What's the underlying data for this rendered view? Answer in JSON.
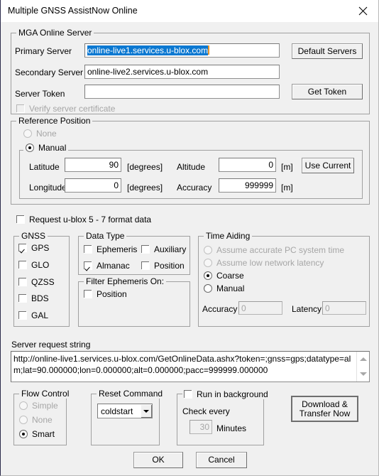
{
  "window": {
    "title": "Multiple GNSS AssistNow Online",
    "close_icon": "close-icon"
  },
  "mga_online_server": {
    "legend": "MGA Online Server",
    "primary_label": "Primary Server",
    "primary_value": "online-live1.services.u-blox.com",
    "secondary_label": "Secondary Server",
    "secondary_value": "online-live2.services.u-blox.com",
    "token_label": "Server Token",
    "token_value": "",
    "token_placeholder": "",
    "default_servers_button": "Default Servers",
    "get_token_button": "Get Token",
    "verify_cert_label": "Verify server certificate",
    "verify_cert_checked": false,
    "verify_cert_enabled": false
  },
  "reference_position": {
    "legend": "Reference Position",
    "none_label": "None",
    "manual_label": "Manual",
    "selected": "Manual",
    "latitude_label": "Latitude",
    "latitude_value": "90",
    "latitude_units": "[degrees]",
    "longitude_label": "Longitude",
    "longitude_value": "0",
    "longitude_units": "[degrees]",
    "altitude_label": "Altitude",
    "altitude_value": "0",
    "altitude_units": "[m]",
    "accuracy_label": "Accuracy",
    "accuracy_value": "999999",
    "accuracy_units": "[m]",
    "use_current_button": "Use Current"
  },
  "request_legacy_format": {
    "label": "Request u-blox 5 - 7 format data",
    "checked": false
  },
  "gnss": {
    "legend": "GNSS",
    "items": [
      {
        "label": "GPS",
        "checked": true
      },
      {
        "label": "GLO",
        "checked": false
      },
      {
        "label": "QZSS",
        "checked": false
      },
      {
        "label": "BDS",
        "checked": false
      },
      {
        "label": "GAL",
        "checked": false
      }
    ]
  },
  "data_type": {
    "legend": "Data Type",
    "items": [
      {
        "label": "Ephemeris",
        "checked": false
      },
      {
        "label": "Auxiliary",
        "checked": false
      },
      {
        "label": "Almanac",
        "checked": true
      },
      {
        "label": "Position",
        "checked": false
      }
    ]
  },
  "filter_ephemeris": {
    "legend": "Filter Ephemeris On:",
    "position_label": "Position",
    "position_checked": false
  },
  "time_aiding": {
    "legend": "Time Aiding",
    "options": [
      {
        "label": "Assume accurate PC system time",
        "selected": false,
        "enabled": false
      },
      {
        "label": "Assume low network latency",
        "selected": false,
        "enabled": false
      },
      {
        "label": "Coarse",
        "selected": true,
        "enabled": true
      },
      {
        "label": "Manual",
        "selected": false,
        "enabled": true
      }
    ],
    "accuracy_label": "Accuracy",
    "accuracy_value": "0",
    "accuracy_enabled": false,
    "latency_label": "Latency",
    "latency_value": "0",
    "latency_enabled": false
  },
  "server_request": {
    "label": "Server request string",
    "value": "http://online-live1.services.u-blox.com/GetOnlineData.ashx?token=;gnss=gps;datatype=alm;lat=90.000000;lon=0.000000;alt=0.000000;pacc=999999.000000"
  },
  "flow_control": {
    "legend": "Flow Control",
    "options": [
      {
        "label": "Simple",
        "selected": false,
        "enabled": false
      },
      {
        "label": "None",
        "selected": false,
        "enabled": false
      },
      {
        "label": "Smart",
        "selected": true,
        "enabled": true
      }
    ]
  },
  "reset_command": {
    "legend": "Reset Command",
    "value": "coldstart",
    "options": [
      "coldstart"
    ]
  },
  "run_in_background": {
    "legend": "Run in background",
    "checked": false,
    "check_every_label": "Check every",
    "interval_value": "30",
    "interval_units": "Minutes",
    "interval_enabled": false
  },
  "actions": {
    "download_transfer_button": "Download &\nTransfer Now",
    "download_transfer_line1": "Download &",
    "download_transfer_line2": "Transfer Now",
    "ok_button": "OK",
    "cancel_button": "Cancel"
  },
  "colors": {
    "dialog_bg": "#f0f0f0",
    "titlebar_bg": "#ffffff",
    "selection_blue": "#0b78d1",
    "caret_orange": "#e8952a",
    "disabled_text": "#a6a6a6",
    "group_border": "#a0a0a0"
  }
}
